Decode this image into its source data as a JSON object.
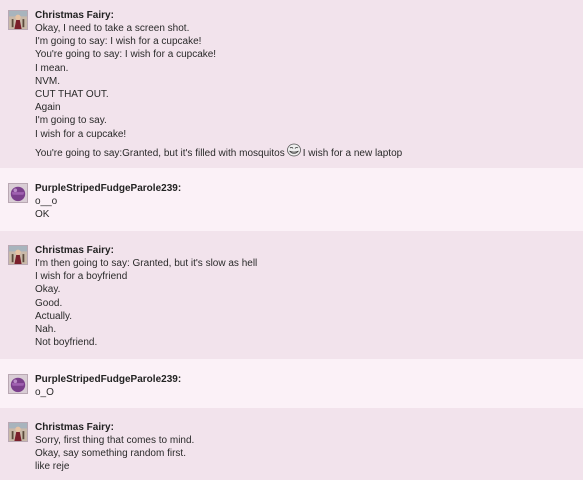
{
  "thread": {
    "posts": [
      {
        "author": "Christmas Fairy:",
        "avatar": "fairy-avatar",
        "lines": [
          "Okay, I need to take a screen shot.",
          "I'm going to say: I wish for a cupcake!",
          "You're going to say: I wish for a cupcake!",
          "I mean.",
          "NVM.",
          "CUT THAT OUT.",
          "Again",
          "I'm going to say.",
          "I wish for a cupcake!"
        ],
        "last_line_before": "You're going to say:Granted, but it's filled with mosquitos",
        "last_line_emote": "trollface-icon",
        "last_line_after": "I wish for a new laptop"
      },
      {
        "author": "PurpleStripedFudgeParole239:",
        "avatar": "purple-ball-avatar",
        "lines": [
          "o__o",
          "OK"
        ]
      },
      {
        "author": "Christmas Fairy:",
        "avatar": "fairy-avatar",
        "lines": [
          "I'm then going to say: Granted, but it's slow as hell",
          "I wish for a boyfriend",
          "Okay.",
          "Good.",
          "Actually.",
          "Nah.",
          "Not boyfriend."
        ]
      },
      {
        "author": "PurpleStripedFudgeParole239:",
        "avatar": "purple-ball-avatar",
        "lines": [
          "o_O"
        ]
      },
      {
        "author": "Christmas Fairy:",
        "avatar": "fairy-avatar",
        "lines": [
          "Sorry, first thing that comes to mind.",
          "Okay, say something random first.",
          "like reje"
        ]
      }
    ]
  }
}
